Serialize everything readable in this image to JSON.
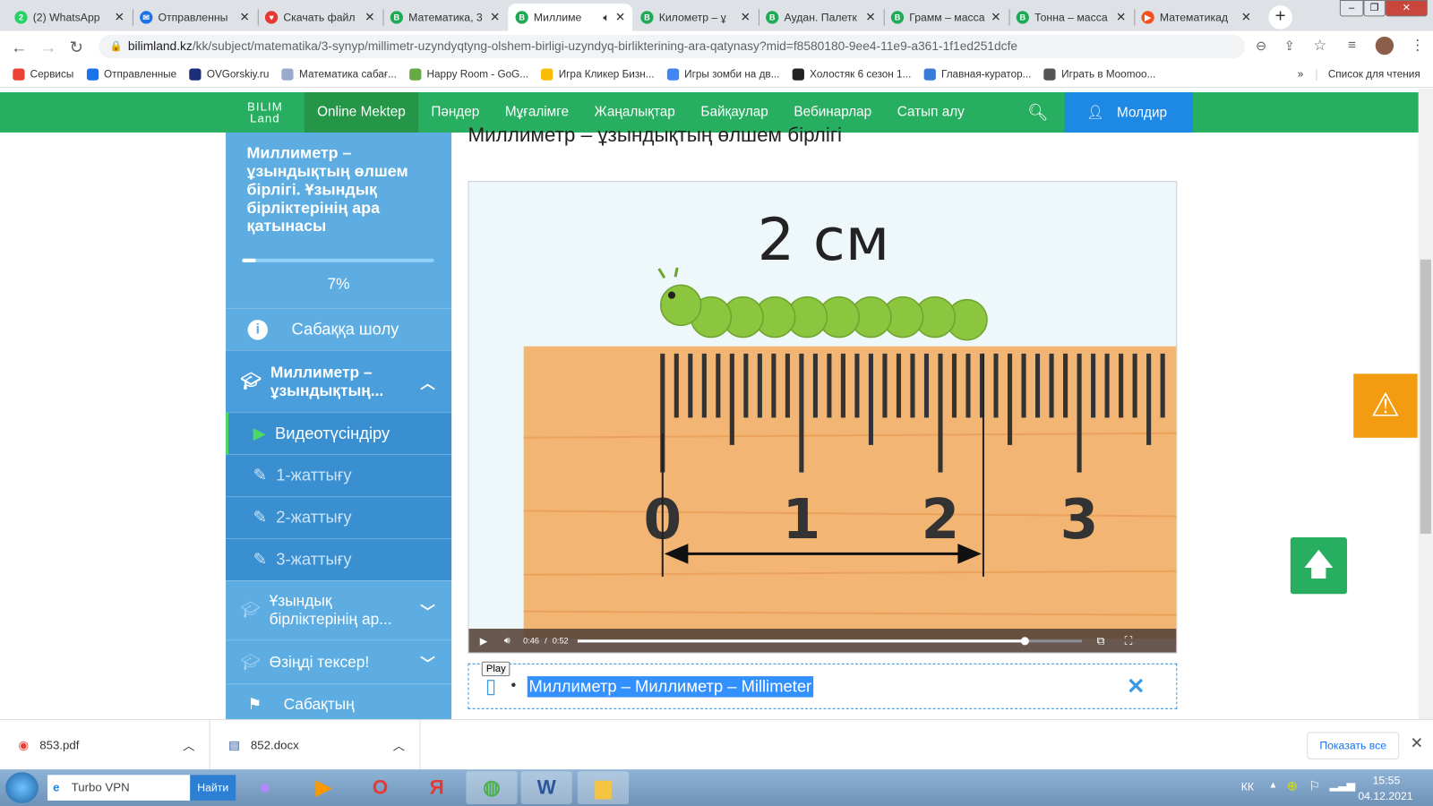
{
  "browser": {
    "tabs": [
      {
        "title": "(2) WhatsApp",
        "icon": "whatsapp-icon",
        "color": "#25d366",
        "glyph": "2"
      },
      {
        "title": "Отправленны",
        "icon": "mail-icon",
        "color": "#1a73e8",
        "glyph": "✉"
      },
      {
        "title": "Скачать файл",
        "icon": "heart-icon",
        "color": "#e53935",
        "glyph": "♥"
      },
      {
        "title": "Математика, 3",
        "icon": "bilimland-icon",
        "color": "#1eab55",
        "glyph": "B"
      },
      {
        "title": "Миллиме",
        "icon": "bilimland-icon",
        "color": "#1eab55",
        "glyph": "B",
        "active": true
      },
      {
        "title": "Километр – ұ",
        "icon": "bilimland-icon",
        "color": "#1eab55",
        "glyph": "B"
      },
      {
        "title": "Аудан. Палетк",
        "icon": "bilimland-icon",
        "color": "#1eab55",
        "glyph": "B"
      },
      {
        "title": "Грамм – масса",
        "icon": "bilimland-icon",
        "color": "#1eab55",
        "glyph": "B"
      },
      {
        "title": "Тонна – масса",
        "icon": "bilimland-icon",
        "color": "#1eab55",
        "glyph": "B"
      },
      {
        "title": "Математикад",
        "icon": "play-orange-icon",
        "color": "#f4511e",
        "glyph": "▶"
      }
    ],
    "url_host": "bilimland.kz",
    "url_path": "/kk/subject/matematika/3-synyp/millimetr-uzyndyqtyng-olshem-birligi-uzyndyq-birlikterining-ara-qatynasy?mid=f8580180-9ee4-11e9-a361-1f1ed251dcfe",
    "bookmarks": [
      "Сервисы",
      "Отправленные",
      "OVGorskiy.ru",
      "Математика сабағ...",
      "Happy Room - GoG...",
      "Игра Кликер Бизн...",
      "Игры зомби на дв...",
      "Холостяк 6 сезон 1...",
      "Главная-куратор...",
      "Играть в Moomoo..."
    ],
    "bookmark_colors": [
      "#ea4335",
      "#1a73e8",
      "#1d2e7a",
      "#9ac",
      "#6a4",
      "#fbbc05",
      "#4285f4",
      "#222",
      "#3a7bd5",
      "#555"
    ],
    "more": "»",
    "reading_list": "Список для чтения"
  },
  "site": {
    "logo_top": "BILIM",
    "logo_bottom": "Land",
    "nav": [
      "Online Mektep",
      "Пәндер",
      "Мұғалімге",
      "Жаңалықтар",
      "Байқаулар",
      "Вебинарлар",
      "Сатып алу"
    ],
    "user": "Молдир"
  },
  "sidebar": {
    "title": "Миллиметр – ұзындықтың өлшем бірлігі. Ұзындық бірліктерінің ара қатынасы",
    "progress_percent": 7,
    "progress_label": "7%",
    "overview": "Сабаққа шолу",
    "section1": "Миллиметр – ұзындықтың...",
    "items": [
      "Видеотүсіндіру",
      "1-жаттығу",
      "2-жаттығу",
      "3-жаттығу"
    ],
    "section2": "Ұзындық бірліктерінің ар...",
    "section3": "Өзіңді тексер!",
    "section4": "Сабақтың"
  },
  "content": {
    "title": "Миллиметр – ұзындықтың өлшем бірлігі",
    "video": {
      "caption": "2 см",
      "ruler_numbers": [
        "0",
        "1",
        "2",
        "3"
      ],
      "current_time": "0:46",
      "separator": "/",
      "duration": "0:52",
      "progress_fraction": 0.885
    },
    "tooltip": "Play",
    "glossary": "Миллиметр – Миллиметр – Millimeter",
    "bullet": "•"
  },
  "downloads": {
    "files": [
      "853.pdf",
      "852.docx"
    ],
    "show_all": "Показать все"
  },
  "taskbar": {
    "search_value": "Turbo VPN",
    "search_button": "Найти",
    "lang": "КК",
    "time": "15:55",
    "date": "04.12.2021"
  }
}
